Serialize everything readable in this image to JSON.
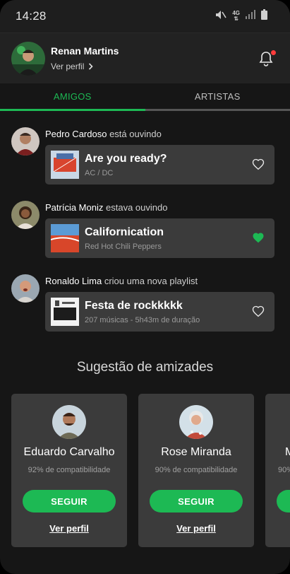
{
  "status_bar": {
    "time": "14:28",
    "network": "4G"
  },
  "header": {
    "user_name": "Renan Martins",
    "view_profile": "Ver perfil",
    "colors": {
      "notification_dot": "#ff3b3b"
    }
  },
  "tabs": [
    {
      "label": "AMIGOS",
      "active": true
    },
    {
      "label": "ARTISTAS",
      "active": false
    }
  ],
  "accent_color": "#1db954",
  "feed": [
    {
      "friend": "Pedro Cardoso",
      "action": "está ouvindo",
      "title": "Are you ready?",
      "subtitle": "AC / DC",
      "liked": false,
      "heart_icon": "heart-outline-icon"
    },
    {
      "friend": "Patrícia Moniz",
      "action": "estava ouvindo",
      "title": "Californication",
      "subtitle": "Red Hot Chili Peppers",
      "liked": true,
      "heart_icon": "heart-filled-icon"
    },
    {
      "friend": "Ronaldo Lima",
      "action": "criou uma nova playlist",
      "title": "Festa de rockkkkk",
      "subtitle": "207 músicas - 5h43m de duração",
      "liked": false,
      "heart_icon": "heart-outline-icon"
    }
  ],
  "suggestions": {
    "title": "Sugestão de amizades",
    "cards": [
      {
        "name": "Eduardo Carvalho",
        "compat": "92% de compatibilidade",
        "follow": "SEGUIR",
        "view_profile": "Ver perfil"
      },
      {
        "name": "Rose Miranda",
        "compat": "90% de compatibilidade",
        "follow": "SEGUIR",
        "view_profile": "Ver perfil"
      },
      {
        "name": "M",
        "compat": "90%",
        "follow": "",
        "view_profile": ""
      }
    ]
  }
}
